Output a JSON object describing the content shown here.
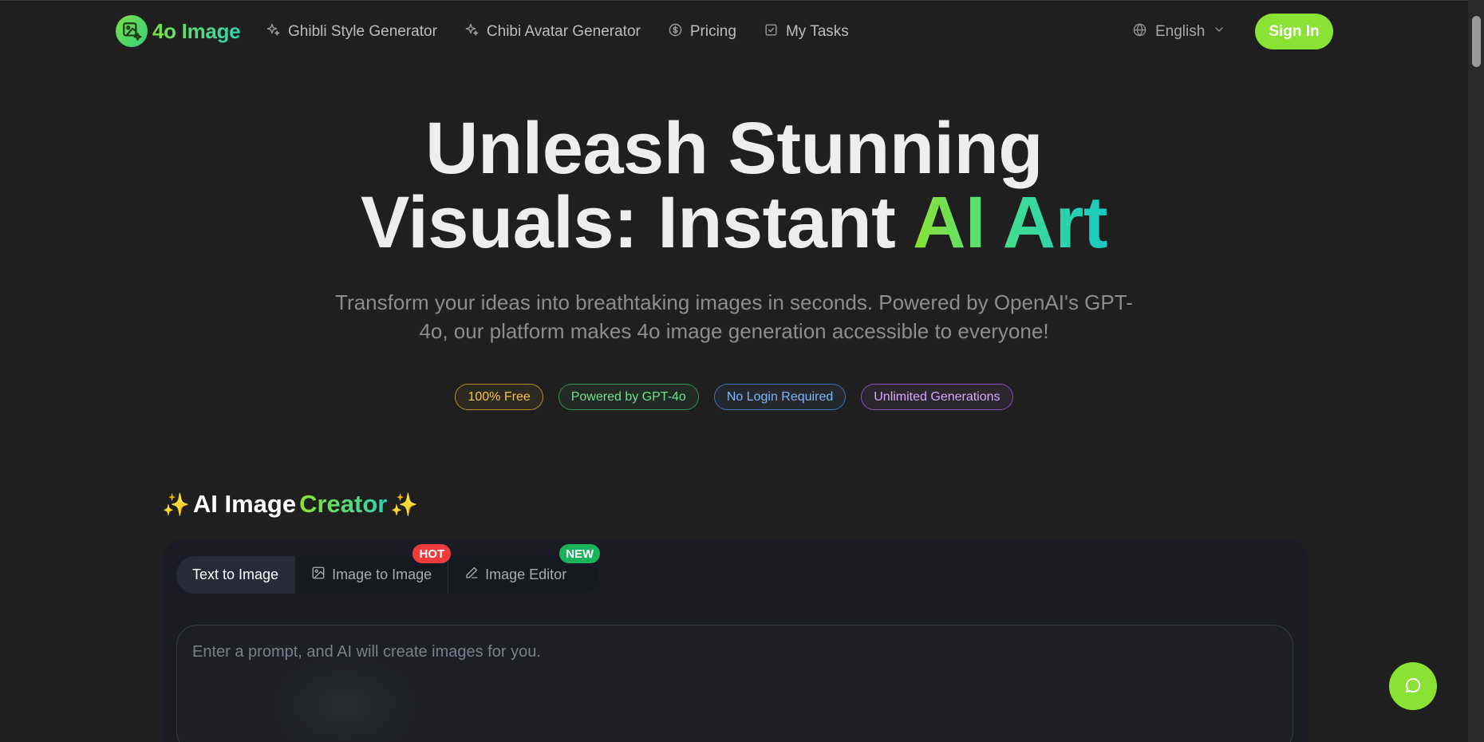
{
  "brand": {
    "name": "4o Image",
    "accent": "#8ae234"
  },
  "nav": {
    "links": [
      {
        "label": "Ghibli Style Generator",
        "icon": "sparkles-icon"
      },
      {
        "label": "Chibi Avatar Generator",
        "icon": "sparkles-icon"
      },
      {
        "label": "Pricing",
        "icon": "dollar-circle-icon"
      },
      {
        "label": "My Tasks",
        "icon": "checkbox-icon"
      }
    ],
    "language": "English",
    "signin_label": "Sign In"
  },
  "hero": {
    "title_line1": "Unleash Stunning",
    "title_line2_plain": "Visuals: Instant ",
    "title_line2_accent": "AI Art",
    "subtitle": "Transform your ideas into breathtaking images in seconds. Powered by OpenAI's GPT-4o, our platform makes 4o image generation accessible to everyone!",
    "badges": [
      {
        "label": "100% Free",
        "color": "#f4c542"
      },
      {
        "label": "Powered by GPT-4o",
        "color": "#6ee08e"
      },
      {
        "label": "No Login Required",
        "color": "#7fb6ff"
      },
      {
        "label": "Unlimited Generations",
        "color": "#d8a6ff"
      }
    ]
  },
  "creator": {
    "spark_left": "✨",
    "title_plain": "AI Image",
    "title_accent": "Creator",
    "spark_right": "✨",
    "tabs": [
      {
        "label": "Text to Image",
        "active": true
      },
      {
        "label": "Image to Image",
        "tag": "HOT",
        "icon": "image-icon"
      },
      {
        "label": "Image Editor",
        "tag": "NEW",
        "icon": "pencil-icon"
      }
    ],
    "prompt_placeholder": "Enter a prompt, and AI will create images for you.",
    "prompt_value": ""
  },
  "chat": {
    "icon": "chat-bubble-icon"
  }
}
